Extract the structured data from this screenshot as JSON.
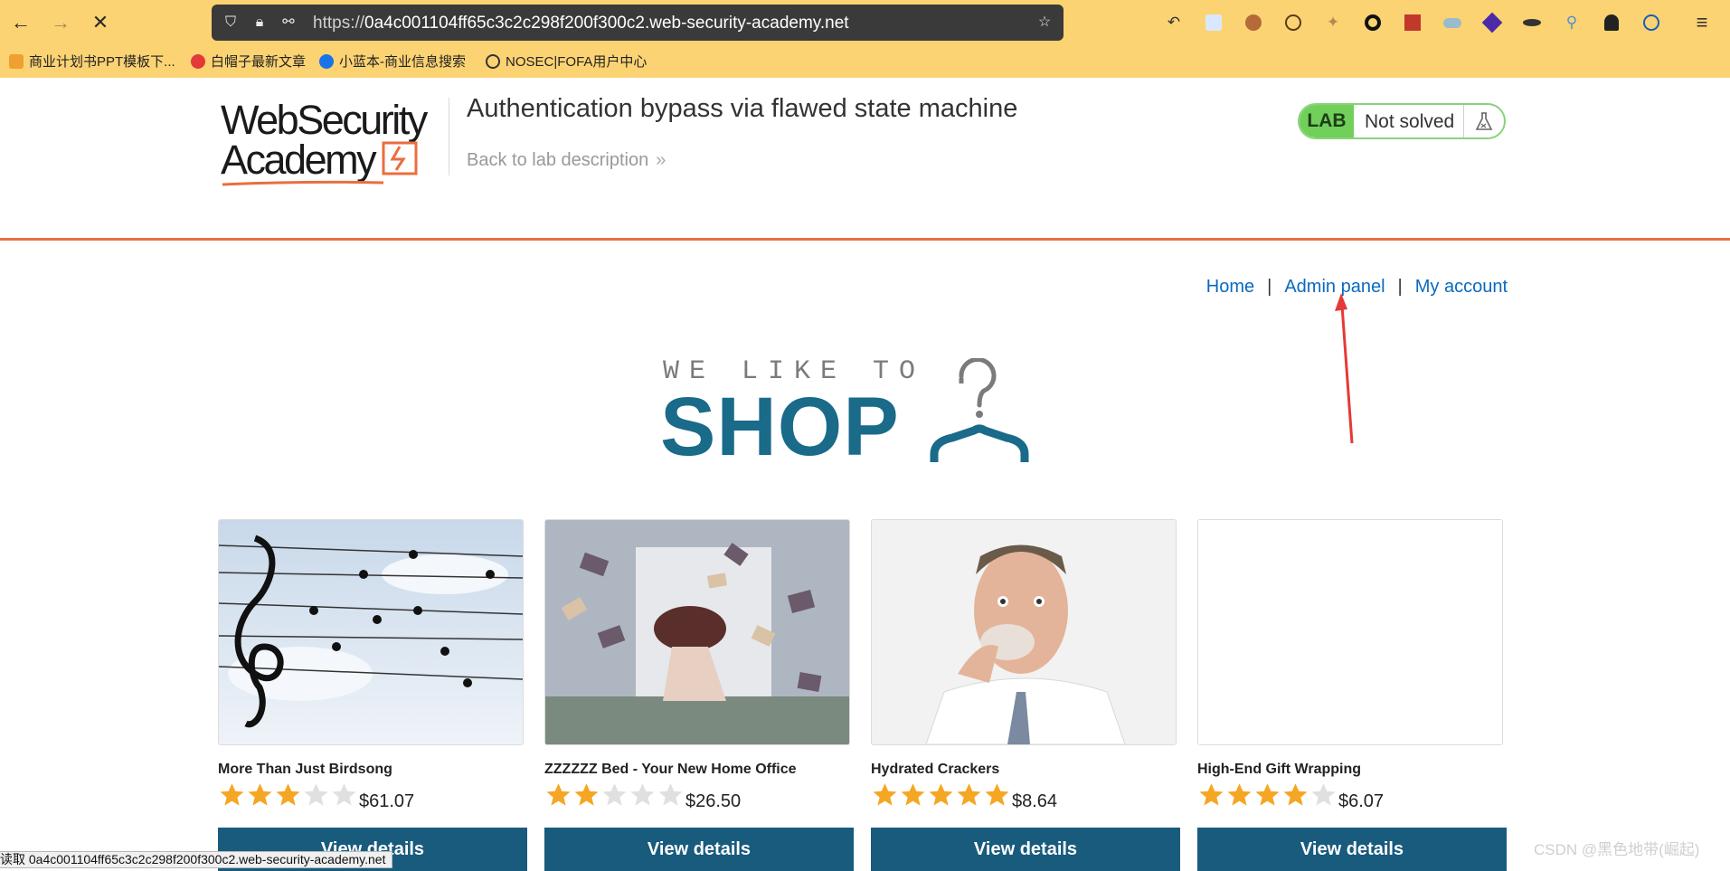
{
  "browser": {
    "url_proto": "https://",
    "url_sub": "0a4c001104ff65c3c2c298f200f300c2",
    "url_domain": ".web-security-academy.net",
    "bookmarks": [
      {
        "label": "商业计划书PPT模板下...",
        "color": "#f0a030"
      },
      {
        "label": "白帽子最新文章",
        "color": "#e23a3a"
      },
      {
        "label": "小蓝本-商业信息搜索",
        "color": "#1a73e8"
      },
      {
        "label": "NOSEC|FOFA用户中心",
        "color": "#333333"
      }
    ]
  },
  "header": {
    "logo_line1": "WebSecurity",
    "logo_line2": "Academy",
    "lab_title": "Authentication bypass via flawed state machine",
    "back_link": "Back to lab description",
    "back_chevron": "»",
    "status_badge": "LAB",
    "status_text": "Not solved"
  },
  "nav": {
    "home": "Home",
    "admin": "Admin panel",
    "account": "My account",
    "separator": "|"
  },
  "banner": {
    "tagline": "WE LIKE TO",
    "shop": "SHOP"
  },
  "products": [
    {
      "name": "More Than Just Birdsong",
      "rating": 3,
      "price": "$61.07",
      "button": "View details"
    },
    {
      "name": "ZZZZZZ Bed - Your New Home Office",
      "rating": 2,
      "price": "$26.50",
      "button": "View details"
    },
    {
      "name": "Hydrated Crackers",
      "rating": 5,
      "price": "$8.64",
      "button": "View details"
    },
    {
      "name": "High-End Gift Wrapping",
      "rating": 4,
      "price": "$6.07",
      "button": "View details"
    }
  ],
  "statusbar": "读取 0a4c001104ff65c3c2c298f200f300c2.web-security-academy.net",
  "watermark": "CSDN @黑色地带(崛起)",
  "colors": {
    "chrome": "#fcd372",
    "accent_orange": "#ea6e3f",
    "link_blue": "#0a6abf",
    "button_blue": "#185b7d",
    "lab_green": "#70d05a",
    "star_gold": "#f5a623"
  }
}
